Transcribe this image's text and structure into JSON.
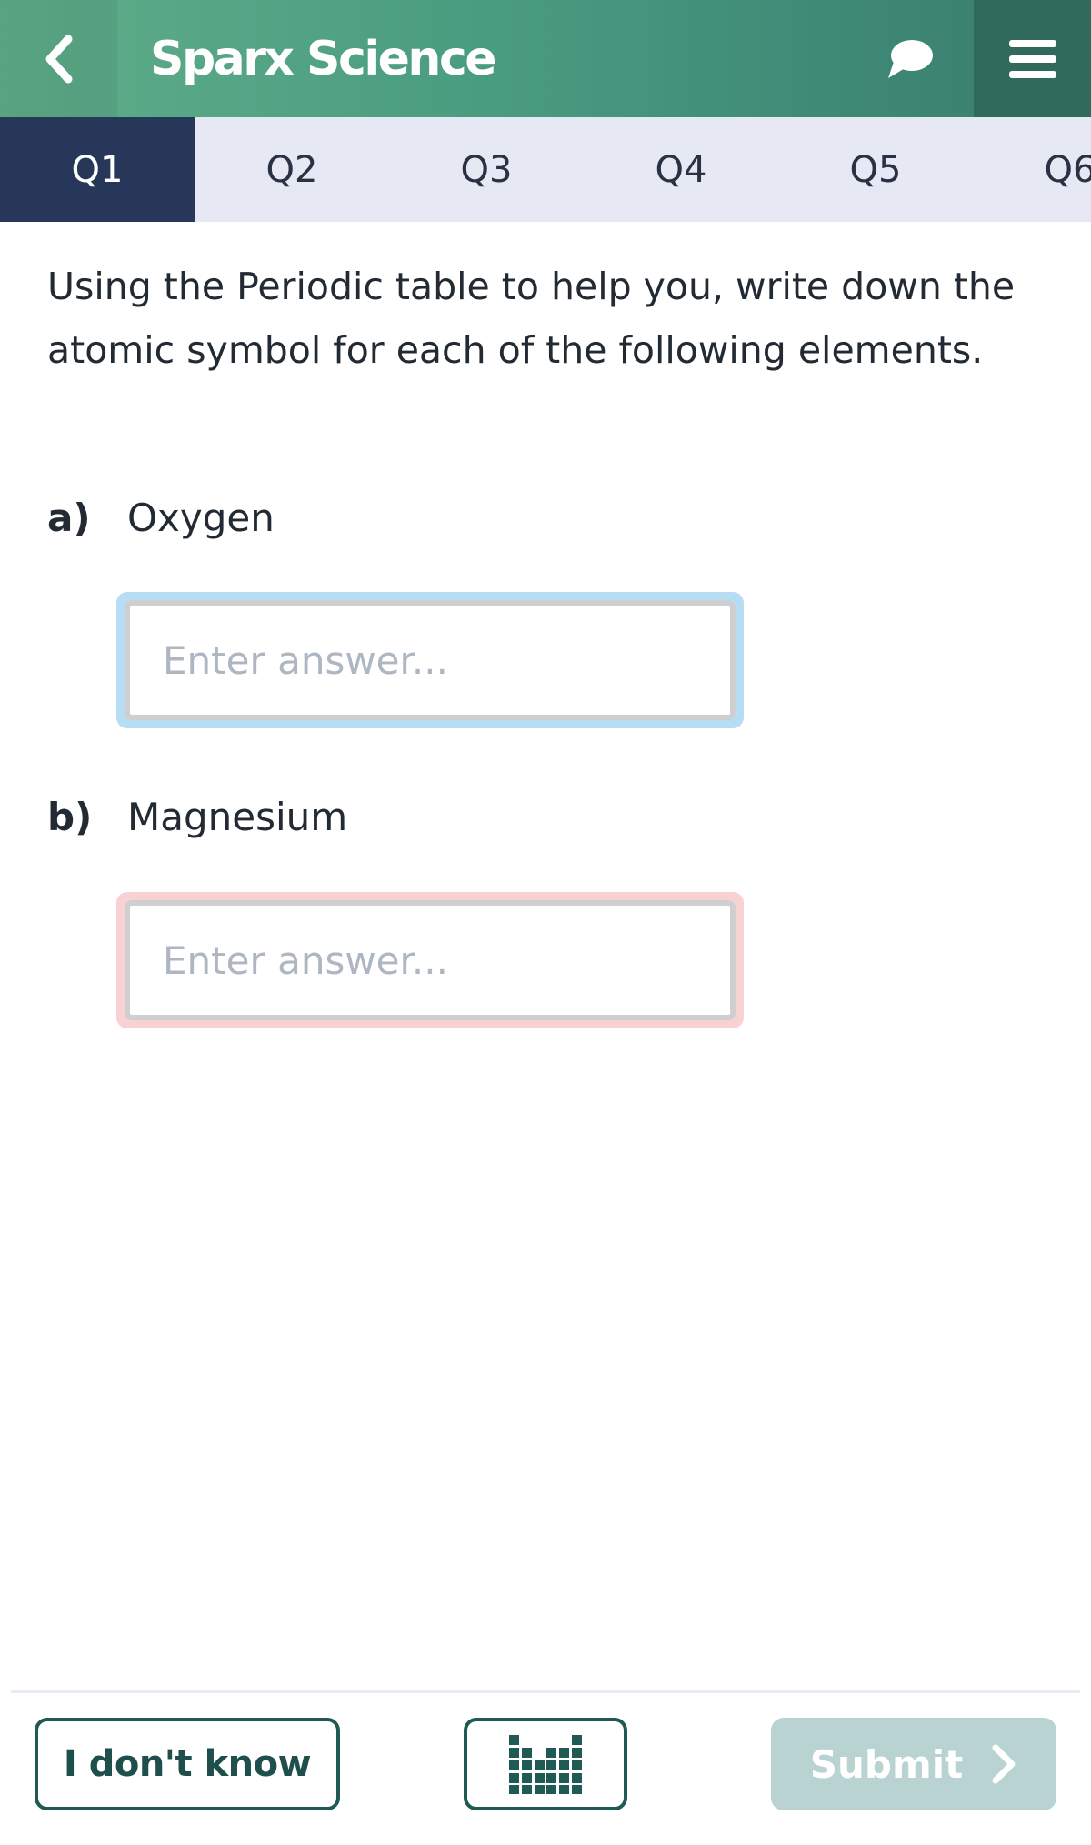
{
  "header": {
    "title": "Sparx Science",
    "back_icon": "chevron-left-icon",
    "chat_icon": "speech-bubble-icon",
    "menu_icon": "hamburger-menu-icon"
  },
  "tabs": [
    {
      "label": "Q1",
      "active": true
    },
    {
      "label": "Q2",
      "active": false
    },
    {
      "label": "Q3",
      "active": false
    },
    {
      "label": "Q4",
      "active": false
    },
    {
      "label": "Q5",
      "active": false
    },
    {
      "label": "Q6",
      "active": false
    }
  ],
  "question": {
    "text": "Using the Periodic table to help you, write down the atomic symbol for each of the following elements.",
    "parts": [
      {
        "label": "a)",
        "name": "Oxygen",
        "placeholder": "Enter answer...",
        "value": "",
        "state": "focused"
      },
      {
        "label": "b)",
        "name": "Magnesium",
        "placeholder": "Enter answer...",
        "value": "",
        "state": "error"
      }
    ]
  },
  "footer": {
    "dont_know_label": "I don't know",
    "periodic_table_icon": "periodic-table-icon",
    "submit_label": "Submit",
    "submit_icon": "chevron-right-icon"
  },
  "colors": {
    "header_green": "#4a9c80",
    "tab_active": "#26375a",
    "tab_bar": "#e6e9f3",
    "focus_ring": "#b7ddf5",
    "error_ring": "#f8d2d3",
    "button_border": "#1f5a55",
    "submit_disabled": "#b9d2d2"
  }
}
